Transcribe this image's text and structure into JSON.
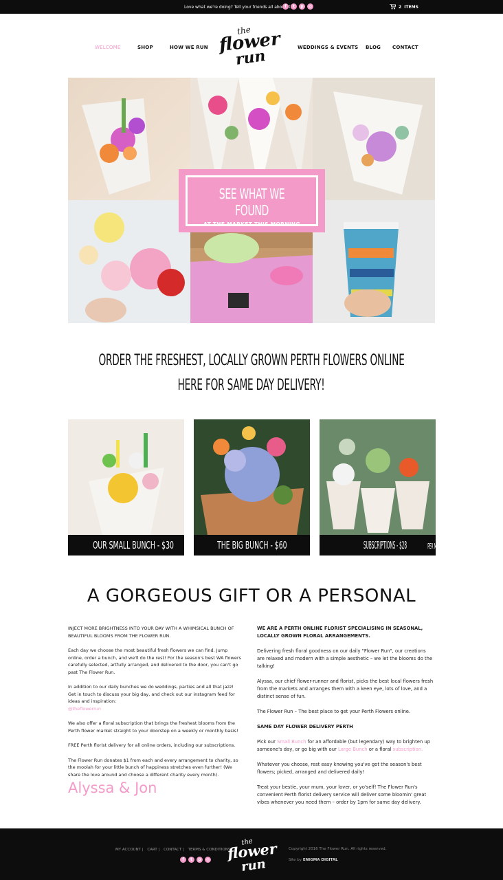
{
  "topbar": {
    "promo": "Love what we're doing? Tell your friends all about it!",
    "social": [
      "facebook-icon",
      "twitter-icon",
      "pinterest-icon",
      "instagram-icon"
    ],
    "cart_count": "2",
    "cart_label": "ITEMS"
  },
  "nav": {
    "items": [
      "WELCOME",
      "SHOP",
      "HOW WE RUN",
      "WEDDINGS & EVENTS",
      "BLOG",
      "CONTACT"
    ],
    "logo_text": [
      "the",
      "flower",
      "run"
    ]
  },
  "hero": {
    "badge_title": "SEE WHAT WE FOUND",
    "badge_sub": "AT THE MARKET THIS MORNING"
  },
  "headline": {
    "line1": "ORDER THE FRESHEST, LOCALLY GROWN PERTH FLOWERS ONLINE",
    "line2": "HERE FOR SAME DAY DELIVERY!"
  },
  "products": [
    {
      "label": "OUR SMALL BUNCH - $30"
    },
    {
      "label": "THE BIG BUNCH - $60"
    },
    {
      "label": "SUBSCRIPTIONS - $28",
      "suffix": "PER MONTH"
    }
  ],
  "gift": {
    "title": "A GORGEOUS GIFT OR A PERSONAL",
    "left": {
      "intro": "INJECT MORE BRIGHTNESS INTO YOUR DAY WITH A WHIMSICAL BUNCH OF BEAUTIFUL BLOOMS FROM THE FLOWER RUN.",
      "p1": "Each day we choose the most beautiful fresh flowers we can find. Jump online, order a bunch, and we'll do the rest! For the season's best WA flowers carefully selected, artfully arranged, and delivered to the door, you can't go past The Flower Run.",
      "p2": "In addition to our daily bunches we do weddings, parties and all that jazz! Get in touch to discuss your big day, and check out our instagram feed for ideas and inspiration:",
      "p2_link": "@theflowerrun",
      "p3": "We also offer a floral subscription that brings the freshest blooms from the Perth flower market straight to your doorstep on a weekly or monthly basis!",
      "p4": "FREE Perth florist delivery for all online orders, including our subscriptions.",
      "p5": "The Flower Run donates $1 from each and every arrangement to charity, so the moolah for your little bunch of happiness stretches even further! (We share the love around and choose a different charity every month).",
      "signature": "Alyssa & Jon"
    },
    "right": {
      "heading": "WE ARE A PERTH ONLINE FLORIST SPECIALISING IN SEASONAL, LOCALLY GROWN FLORAL ARRANGEMENTS.",
      "p1": "Delivering fresh floral goodness on our daily \"Flower Run\", our creations are relaxed and modern with a simple aesthetic – we let the blooms do the talking!",
      "p2": "Alyssa, our chief flower-runner and florist, picks the best local flowers fresh from the markets and arranges them with a keen eye, lots of love, and a distinct sense of fun.",
      "p3": "The Flower Run – The best place to get your Perth Flowers online.",
      "heading2": "SAME DAY FLOWER DELIVERY PERTH",
      "p4a": "Pick our",
      "p4_link1": "Small Bunch",
      "p4b": "for an affordable (but legendary) way to brighten up someone's day, or go big with our",
      "p4_link2": "Large Bunch",
      "p4c": "or a floral",
      "p4_link3": "subscription.",
      "p5": "Whatever you choose, rest easy knowing you've got the season's best flowers; picked, arranged and delivered daily!",
      "p6": "Treat your bestie, your mum, your lover, or yo'self! The Flower Run's convenient Perth florist delivery service will deliver some bloomin' great vibes whenever you need them – order by 1pm for same day delivery."
    }
  },
  "footer": {
    "links": [
      "MY ACCOUNT",
      "CART",
      "CONTACT",
      "TERMS & CONDITIONS"
    ],
    "copyright": "Copyright 2016 The Flower Run. All rights reserved.",
    "credit_label": "Site by",
    "credit_name": "ENIGMA DIGITAL"
  },
  "colors": {
    "accent": "#f49ac9",
    "dark": "#0d0d0d"
  }
}
